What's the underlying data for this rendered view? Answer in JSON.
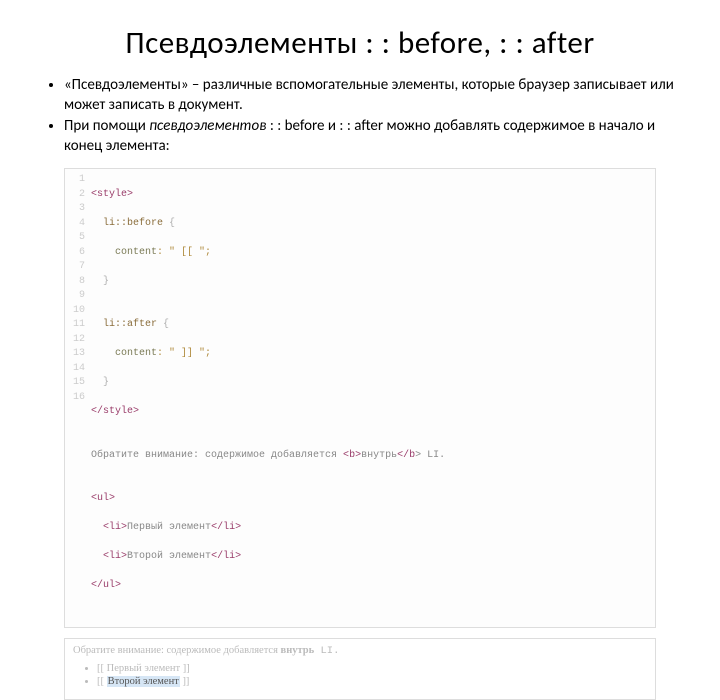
{
  "title": "Псевдоэлементы : : before, : : after",
  "bullets": {
    "b1_a": "«Псевдоэлементы» – различные вспомогательные элементы, которые браузер записывает или может записать в документ.",
    "b2_a": "При помощи ",
    "b2_em": "псевдоэлементов",
    "b2_b": " : : before и : : after можно добавлять содержимое в начало и конец элемента:"
  },
  "code": {
    "lines": {
      "l1": "1",
      "l2": "2",
      "l3": "3",
      "l4": "4",
      "l5": "5",
      "l6": "6",
      "l7": "7",
      "l8": "8",
      "l9": "9",
      "l10": "10",
      "l11": "11",
      "l12": "12",
      "l13": "13",
      "l14": "14",
      "l15": "15",
      "l16": "16"
    },
    "c1_a": "<",
    "c1_b": "style",
    "c1_c": ">",
    "c2_a": "  li::before",
    "c2_b": " {",
    "c3_a": "    content",
    "c3_b": ": \" [[ \";",
    "c4_a": "  }",
    "c5_a": "",
    "c6_a": "  li::after",
    "c6_b": " {",
    "c7_a": "    content",
    "c7_b": ": \" ]] \";",
    "c8_a": "  }",
    "c9_a": "</",
    "c9_b": "style",
    "c9_c": ">",
    "c10_a": "",
    "c11_a": "Обратите внимание: содержимое добавляется ",
    "c11_b": "<",
    "c11_c": "b",
    "c11_d": ">",
    "c11_e": "внутрь",
    "c11_f": "</",
    "c11_g": "b",
    "c11_h": "> LI.",
    "c12_a": "",
    "c13_a": "<",
    "c13_b": "ul",
    "c13_c": ">",
    "c14_a": "  <",
    "c14_b": "li",
    "c14_c": ">",
    "c14_d": "Первый элемент",
    "c14_e": "</",
    "c14_f": "li",
    "c14_g": ">",
    "c15_a": "  <",
    "c15_b": "li",
    "c15_c": ">",
    "c15_d": "Второй элемент",
    "c15_e": "</",
    "c15_f": "li",
    "c15_g": ">",
    "c16_a": "</",
    "c16_b": "ul",
    "c16_c": ">"
  },
  "output": {
    "note_a": "Обратите внимание: содержимое добавляется ",
    "note_b": "внутрь",
    "note_c": " LI.",
    "li_code": "LI",
    "item1_pre": "[[ ",
    "item1_txt": "Первый элемент",
    "item1_post": " ]]",
    "item2_pre": "[[ ",
    "item2_txt": "Второй элемент",
    "item2_post": " ]]"
  }
}
